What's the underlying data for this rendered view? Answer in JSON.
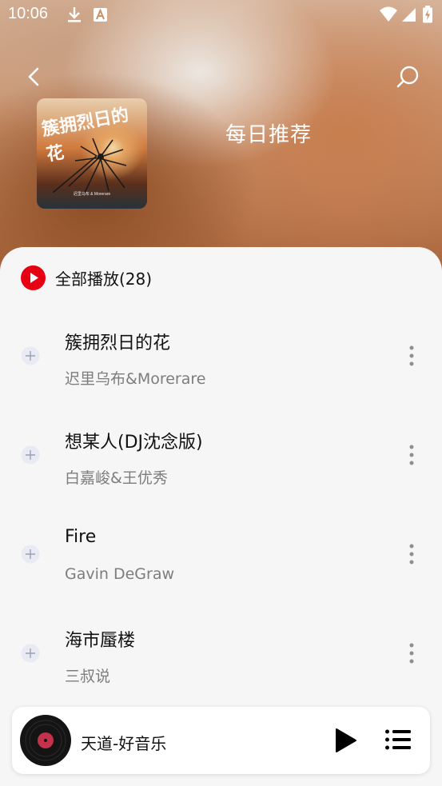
{
  "status_bar": {
    "time": "10:06"
  },
  "header": {
    "title": "每日推荐"
  },
  "cover": {
    "art_text": "簇拥烈日的花",
    "caption": "迟里乌布 & Morerare"
  },
  "play_all": {
    "label": "全部播放(28)"
  },
  "songs": [
    {
      "title": "簇拥烈日的花",
      "artist": "迟里乌布&Morerare"
    },
    {
      "title": "想某人(DJ沈念版)",
      "artist": "白嘉峻&王优秀"
    },
    {
      "title": "Fire",
      "artist": "Gavin DeGraw"
    },
    {
      "title": "海市蜃楼",
      "artist": "三叔说"
    }
  ],
  "player": {
    "title": "天道-好音乐"
  },
  "colors": {
    "accent": "#e60012",
    "text": "#111111",
    "subtext": "#7d7d7d"
  },
  "icons": [
    "download-icon",
    "app-notification-icon",
    "wifi-icon",
    "signal-icon",
    "battery-icon",
    "back-icon",
    "search-icon",
    "play-circle-icon",
    "plus-icon",
    "more-vertical-icon",
    "vinyl-disc-icon",
    "play-icon",
    "playlist-icon"
  ]
}
